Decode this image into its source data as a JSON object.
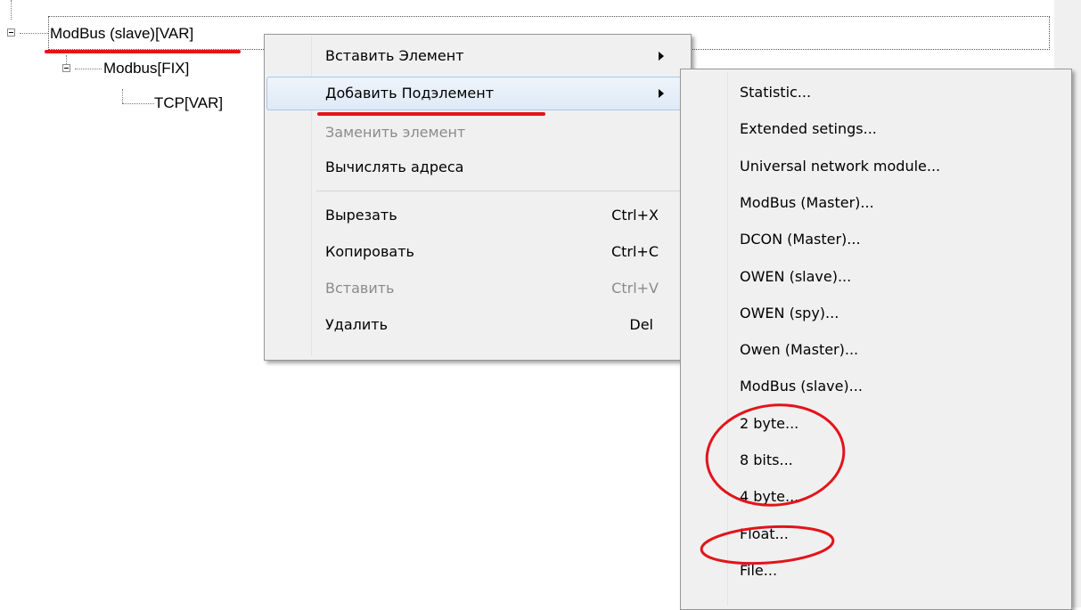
{
  "tree": {
    "root_label": "ModBus (slave)[VAR]",
    "child_label": "Modbus[FIX]",
    "grandchild_label": "TCP[VAR]"
  },
  "context_menu": {
    "items": [
      {
        "label": "Вставить Элемент",
        "submenu": true
      },
      {
        "label": "Добавить Подэлемент",
        "submenu": true,
        "highlighted": true
      },
      {
        "label": "Заменить элемент",
        "disabled": true
      },
      {
        "label": "Вычислять адреса"
      },
      {
        "label": "Вырезать",
        "shortcut": "Ctrl+X"
      },
      {
        "label": "Копировать",
        "shortcut": "Ctrl+C"
      },
      {
        "label": "Вставить",
        "shortcut": "Ctrl+V",
        "disabled": true
      },
      {
        "label": "Удалить",
        "shortcut": "Del"
      }
    ]
  },
  "submenu": {
    "items": [
      "Statistic...",
      "Extended setings...",
      "Universal network module...",
      "ModBus (Master)...",
      "DCON (Master)...",
      "OWEN (slave)...",
      "OWEN (spy)...",
      "Owen (Master)...",
      "ModBus (slave)...",
      "2 byte...",
      "8 bits...",
      "4 byte...",
      "Float...",
      "File..."
    ]
  },
  "colors": {
    "annotation_red": "#e3141b",
    "menu_background": "#f0f0f0",
    "disabled_text": "#8b8b8b",
    "hover_border": "#a9c6e8"
  }
}
